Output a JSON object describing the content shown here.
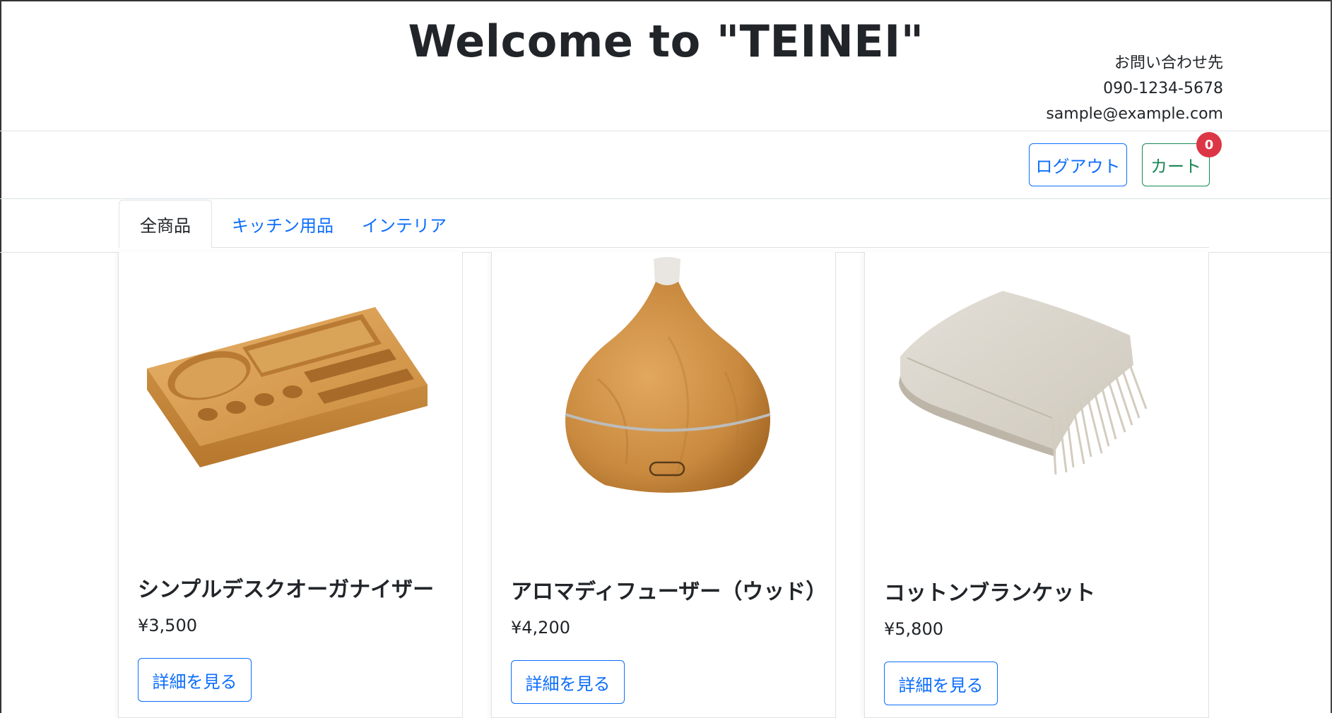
{
  "header": {
    "title": "Welcome to \"TEINEI\"",
    "contact": {
      "label": "お問い合わせ先",
      "phone": "090-1234-5678",
      "email": "sample@example.com"
    }
  },
  "navbar": {
    "logout_label": "ログアウト",
    "cart_label": "カート",
    "cart_count": "0"
  },
  "tabs": [
    {
      "label": "全商品",
      "active": true
    },
    {
      "label": "キッチン用品",
      "active": false
    },
    {
      "label": "インテリア",
      "active": false
    }
  ],
  "products": [
    {
      "name": "シンプルデスクオーガナイザー",
      "price": "¥3,500",
      "button_label": "詳細を見る",
      "image": "wooden-desk-organizer"
    },
    {
      "name": "アロマディフューザー（ウッド）",
      "price": "¥4,200",
      "button_label": "詳細を見る",
      "image": "wood-aroma-diffuser"
    },
    {
      "name": "コットンブランケット",
      "price": "¥5,800",
      "button_label": "詳細を見る",
      "image": "folded-cotton-blanket"
    }
  ],
  "colors": {
    "primary": "#0d6efd",
    "success": "#198754",
    "danger": "#dc3545",
    "text": "#212529",
    "border": "#dee2e6"
  }
}
